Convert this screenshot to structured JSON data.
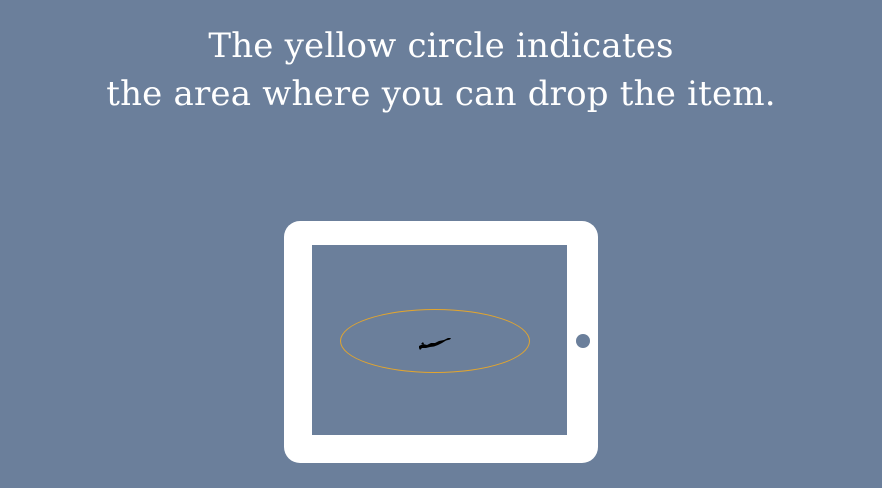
{
  "instruction": {
    "line1": "The yellow circle indicates",
    "line2": "the area where you can drop the item."
  },
  "colors": {
    "background": "#6b7f9b",
    "tablet_frame": "#ffffff",
    "drop_zone_outline": "#e2a52e",
    "item": "#000000"
  },
  "icons": {
    "tablet": "tablet-device",
    "home_button": "circle-button",
    "item": "draggable-item"
  }
}
